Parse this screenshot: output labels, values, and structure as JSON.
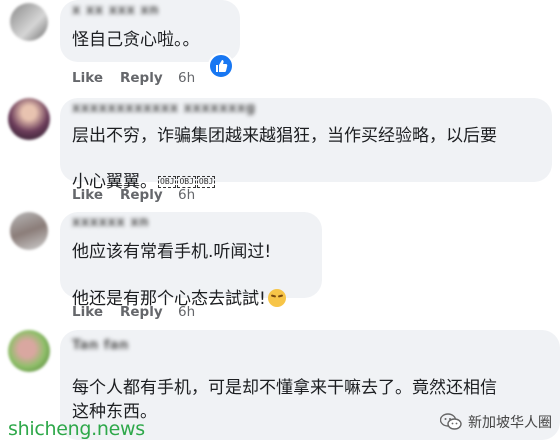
{
  "comments": [
    {
      "author": "x xx xxx xn",
      "text": "怪自己贪心啦。。",
      "like_label": "Like",
      "reply_label": "Reply",
      "time": "6h",
      "has_like_reaction": true
    },
    {
      "author": "xxxxxxxxxxxx xxxxxxxg",
      "text_line1": "层出不穷，诈骗集团越来越猖狂，当作买经验略，以后要",
      "text_line2": "小心翼翼。",
      "obj_labels": [
        "OBJ",
        "OBJ",
        "OBJ"
      ],
      "like_label": "Like",
      "reply_label": "Reply",
      "time": "6h"
    },
    {
      "author": "xxxxxx xn",
      "text_line1": "他应该有常看手机.听闻过!",
      "text_line2": "他还是有那个心态去試試!",
      "emoji": "pensive-face-emoji",
      "like_label": "Like",
      "reply_label": "Reply",
      "time": "6h"
    },
    {
      "author": "Tan fan",
      "text_line1": "每个人都有手机，可是却不懂拿来干嘛去了。竟然还相信",
      "text_line2": "这种东西。"
    }
  ],
  "watermarks": {
    "left": "shicheng.news",
    "right": "新加坡华人圈"
  },
  "colors": {
    "bubble": "#f0f2f5",
    "action_text": "#65676b",
    "like_blue": "#1877f2",
    "watermark_green": "#2ea84a"
  }
}
